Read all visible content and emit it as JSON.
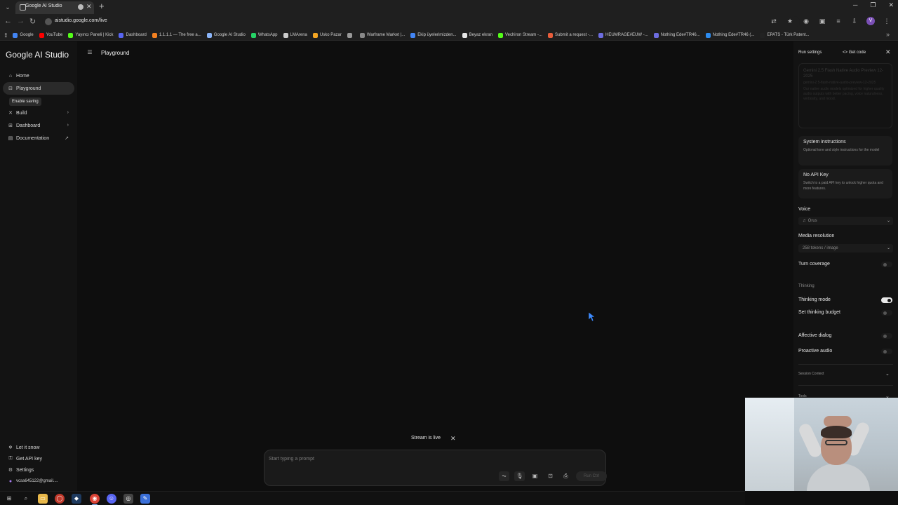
{
  "browser": {
    "tab_title": "Google AI Studio",
    "url": "aistudio.google.com/live",
    "new_tab": "+",
    "bookmarks": [
      {
        "label": "Google",
        "color": "#4285f4"
      },
      {
        "label": "YouTube",
        "color": "#ff0000"
      },
      {
        "label": "Yayıncı Paneli | Kick",
        "color": "#53fc18"
      },
      {
        "label": "Dashboard",
        "color": "#5865f2"
      },
      {
        "label": "1.1.1.1 — The free a...",
        "color": "#f38020"
      },
      {
        "label": "Google AI Studio",
        "color": "#8ab4f8"
      },
      {
        "label": "WhatsApp",
        "color": "#25d366"
      },
      {
        "label": "LMArena",
        "color": "#cccccc"
      },
      {
        "label": "Usko Pazar",
        "color": "#f5a623"
      },
      {
        "label": "",
        "color": "#999999"
      },
      {
        "label": "Warframe Market |...",
        "color": "#888888"
      },
      {
        "label": "Ekip üyelerimizden...",
        "color": "#4285f4"
      },
      {
        "label": "Beyaz ekran",
        "color": "#e6e6e6"
      },
      {
        "label": "Vechiron Stream -...",
        "color": "#53fc18"
      },
      {
        "label": "Submit a request -...",
        "color": "#e85d3b"
      },
      {
        "label": "HEUMRAGE#EUW -...",
        "color": "#6d6de0"
      },
      {
        "label": "Nothing Ede#TR46...",
        "color": "#6d6de0"
      },
      {
        "label": "Nothing Ede#TR46 (...",
        "color": "#2d8cf0"
      },
      {
        "label": "EPATS - Türk Patent...",
        "color": "#222222"
      }
    ]
  },
  "sidebar": {
    "brand": "Google AI Studio",
    "nav": [
      {
        "label": "Home",
        "icon": "home-icon"
      },
      {
        "label": "Playground",
        "icon": "playground-icon"
      },
      {
        "label": "Build",
        "icon": "build-icon"
      },
      {
        "label": "Dashboard",
        "icon": "dashboard-icon"
      },
      {
        "label": "Documentation",
        "icon": "documentation-icon"
      }
    ],
    "enable_saving": "Enable saving",
    "bottom": [
      {
        "label": "Let it snow",
        "icon": "snowflake-icon"
      },
      {
        "label": "Get API key",
        "icon": "key-icon"
      },
      {
        "label": "Settings",
        "icon": "gear-icon"
      }
    ],
    "user_email": "vcsa645122@gmail...."
  },
  "main": {
    "title": "Playground",
    "stream_status": "Stream is live",
    "prompt_placeholder": "Start typing a prompt",
    "run_label": "Run Ctrl"
  },
  "run_settings": {
    "title": "Run settings",
    "get_code": "Get code",
    "model": {
      "name": "Gemini 2.5 Flash Native Audio Preview 12-2025",
      "id": "gemini-2.5-flash-native-audio-preview-12-2025",
      "description": "Our native audio models optimized for higher quality audio outputs with better pacing, voice naturalness, verbosity, and mood."
    },
    "system_instructions": {
      "title": "System instructions",
      "description": "Optional tone and style instructions for the model"
    },
    "no_api_key": {
      "title": "No API Key",
      "description": "Switch to a paid API key to unlock higher quota and more features."
    },
    "voice_label": "Voice",
    "voice_value": "Orus",
    "media_resolution_label": "Media resolution",
    "media_resolution_value": "258 tokens / image",
    "turn_coverage": "Turn coverage",
    "thinking_section": "Thinking",
    "thinking_mode": "Thinking mode",
    "thinking_mode_on": true,
    "set_thinking_budget": "Set thinking budget",
    "affective_dialog": "Affective dialog",
    "proactive_audio": "Proactive audio",
    "session_context": "Session Context",
    "tools": "Tools"
  }
}
